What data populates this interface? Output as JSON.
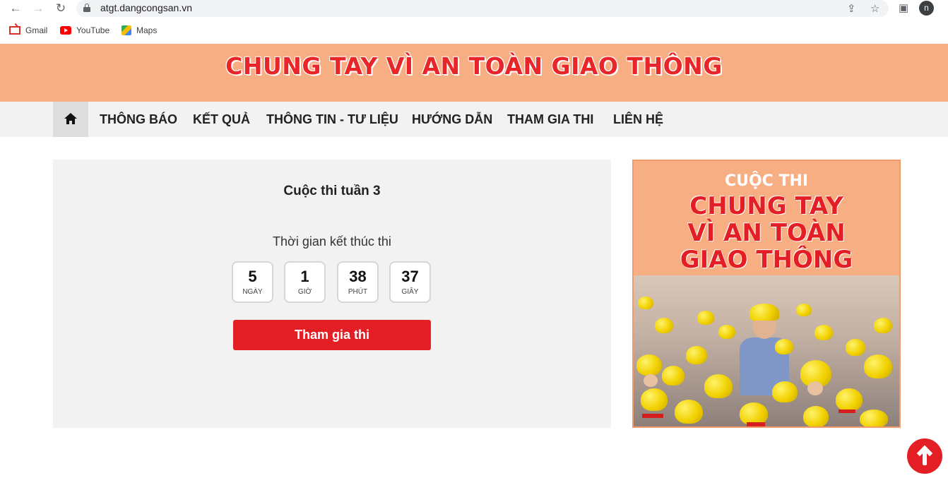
{
  "browser": {
    "url": "atgt.dangcongsan.vn",
    "profile_initial": "n",
    "bookmarks": [
      {
        "label": "Gmail",
        "icon": "gmail-icon"
      },
      {
        "label": "YouTube",
        "icon": "youtube-icon"
      },
      {
        "label": "Maps",
        "icon": "maps-icon"
      }
    ]
  },
  "site": {
    "banner_title": "CHUNG TAY VÌ AN TOÀN GIAO THÔNG",
    "menu": [
      {
        "label": "THÔNG BÁO"
      },
      {
        "label": "KẾT QUẢ"
      },
      {
        "label": "THÔNG TIN - TƯ LIỆU"
      },
      {
        "label": "HƯỚNG DẪN"
      },
      {
        "label": "THAM GIA THI"
      },
      {
        "label": "LIÊN HỆ"
      }
    ]
  },
  "contest": {
    "title": "Cuộc thi tuần 3",
    "end_label": "Thời gian kết thúc thi",
    "countdown": [
      {
        "value": "5",
        "unit": "NGÀY"
      },
      {
        "value": "1",
        "unit": "GIỜ"
      },
      {
        "value": "38",
        "unit": "PHÚT"
      },
      {
        "value": "37",
        "unit": "GIÂY"
      }
    ],
    "join_label": "Tham gia thi"
  },
  "poster": {
    "subtitle": "CUỘC THI",
    "lines": [
      "CHUNG TAY",
      "VÌ AN TOÀN",
      "GIAO THÔNG"
    ]
  },
  "colors": {
    "accent_red": "#e31e24",
    "banner_peach": "#f8ae83"
  }
}
